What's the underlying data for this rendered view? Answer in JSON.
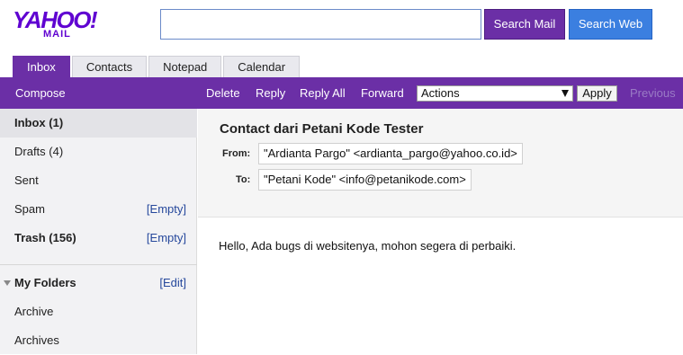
{
  "logo": {
    "brand": "YAHOO!",
    "product": "MAIL"
  },
  "search": {
    "value": "",
    "placeholder": "",
    "mail_button": "Search Mail",
    "web_button": "Search Web"
  },
  "tabs": [
    {
      "label": "Inbox",
      "active": true
    },
    {
      "label": "Contacts",
      "active": false
    },
    {
      "label": "Notepad",
      "active": false
    },
    {
      "label": "Calendar",
      "active": false
    }
  ],
  "toolbar": {
    "compose": "Compose",
    "delete": "Delete",
    "reply": "Reply",
    "reply_all": "Reply All",
    "forward": "Forward",
    "actions_selected": "Actions",
    "apply": "Apply",
    "previous": "Previous"
  },
  "sidebar": {
    "items": [
      {
        "label": "Inbox (1)",
        "action": ""
      },
      {
        "label": "Drafts (4)",
        "action": ""
      },
      {
        "label": "Sent",
        "action": ""
      },
      {
        "label": "Spam",
        "action": "[Empty]"
      },
      {
        "label": "Trash (156)",
        "action": "[Empty]"
      }
    ],
    "folders_title": "My Folders",
    "folders_edit": "[Edit]",
    "folders": [
      "Archive",
      "Archives"
    ]
  },
  "message": {
    "subject": "Contact dari Petani Kode Tester",
    "from_label": "From:",
    "from_value": "\"Ardianta Pargo\" <ardianta_pargo@yahoo.co.id>",
    "to_label": "To:",
    "to_value": "\"Petani Kode\" <info@petanikode.com>",
    "body": "Hello, Ada bugs di websitenya, mohon segera di perbaiki."
  },
  "colors": {
    "brand_purple": "#6b2fa6",
    "web_blue": "#3b7fe0",
    "link_blue": "#26489c"
  }
}
